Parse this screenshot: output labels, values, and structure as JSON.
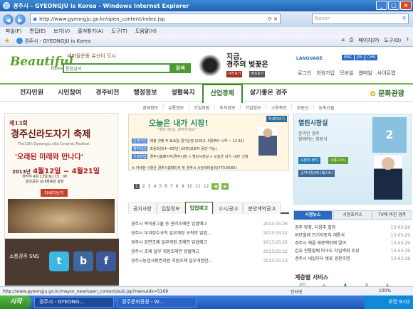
{
  "browser": {
    "title": "경주시 - GYEONGJU is Korea - Windows Internet Explorer",
    "url": "http://www.gyeongju.go.kr/open_content/index.jsp",
    "search_placeholder": "Naver",
    "menu": [
      "파일(F)",
      "편집(E)",
      "보기(V)",
      "즐겨찾기(A)",
      "도구(T)",
      "도움말(H)"
    ],
    "tab_label": "경주시 - GYEONGJU is Korea",
    "tools": [
      "페이지(P)",
      "도구(O)"
    ],
    "status_url": "http://www.gyeongju.go.kr/mayor_new/open_content/sub.jsp?menuIdx=5169",
    "status_zone": "인터넷",
    "zoom": "100%"
  },
  "taskbar": {
    "start": "시작",
    "tasks": [
      "경주시 - GYEONG...",
      "경주문화관광 - W..."
    ],
    "clock": "오전 9:02"
  },
  "site": {
    "logo": "Beautiful",
    "logo_sub": "Gyeongju",
    "slogan": "새마을운동 유산이 도시",
    "search_select": "통합검색",
    "search_btn": "검색",
    "promo_line1": "지금,",
    "promo_line2": "경주의 벚꽃은",
    "promo_btn1": "사진보기",
    "promo_btn2": "영상보기",
    "language": "LANGUAGE",
    "langs": [
      "ENG",
      "JPN",
      "CHN"
    ],
    "toplinks": [
      "로그인",
      "회원가입",
      "모바일",
      "웹메일",
      "사이트맵"
    ],
    "gnb": [
      "전자민원",
      "시민참여",
      "경주비전",
      "행정정보",
      "생활복지",
      "산업경제",
      "살기좋은 경주"
    ],
    "culture": "문화관광",
    "subnav": [
      "경제정보",
      "유통정보",
      "기업지원",
      "투자정보",
      "기업정보",
      "고용촉진",
      "부동산",
      "농축산물"
    ]
  },
  "festival": {
    "head": "제13회",
    "title": "경주신라도자기 축제",
    "en": "The13th Gyeongju silla Ceramic Festival",
    "slogan": "'오래된 미래와 만나다'",
    "date_prefix": "2013년",
    "date1": "4월12일",
    "date_sep": " ~ ",
    "date2": "4월21일",
    "info1": "개막식 4월 13일(토) 15 : 00",
    "info2": "황성공원 실내체육관 광장",
    "btn": "자세히보기",
    "sns_label": "소통경주 SNS"
  },
  "center_banner": {
    "title": "오늘은 내가 시장!",
    "sub": "\"열린시장실, 참여하세요!\"",
    "more": "자세히보기",
    "rows": [
      {
        "tag": "운영기간",
        "text": "매월 넷째 주 토요일 경기운영 (2013. 3월부터 시작 ~ 12.31)"
      },
      {
        "tag": "참여대상",
        "text": "초등학생(4~6학년) 20명(보호자 동반 가능)"
      },
      {
        "tag": "신청방법",
        "text": "경주시홈페이지/경주시청 > 열린시장실 > 오늘은 내가 시장! 신청"
      }
    ],
    "note": "※ 자세한 사항은 경주시홈페이지 및 경주시 시정새마을과(779.6583)"
  },
  "pager": [
    "1",
    "2",
    "3",
    "4",
    "5",
    "6",
    "7",
    "8",
    "9",
    "10",
    "11",
    "12"
  ],
  "news": {
    "tabs": [
      "공지사항",
      "입찰정보",
      "입법예고",
      "고시/공고",
      "분양계약공고"
    ],
    "active": 2,
    "items": [
      {
        "title": "경주시 옥외광고물 등 관리조례안 입법예고",
        "date": "2013.03.26"
      },
      {
        "title": "경주시 부과징수규칙 일부개정 규칙안 입법...",
        "date": "2013.03.22"
      },
      {
        "title": "경주시 감면조례 일부개정 조례안 입법예고",
        "date": "2013.03.22"
      },
      {
        "title": "경주시 조례 일부 개정조례안 입법예고",
        "date": "2013.03.22"
      },
      {
        "title": "경주시농업사용권지원 지원조례 일부개정안...",
        "date": "2013.03.13"
      }
    ]
  },
  "right": {
    "title": "열린시장실",
    "p1": "온라인 경주",
    "p2": "함께하는 희망식",
    "btn1": "시장의 생각",
    "btn2": "소통 24시",
    "btn3": "공약사항(매니페스토)",
    "calendar": "2",
    "tabs": [
      "시정뉴스",
      "시정포커스",
      "TV에 비친 경주"
    ],
    "items": [
      {
        "title": "경주 벚꽃, 다음주 절정",
        "date": "13-03-29"
      },
      {
        "title": "비단벌레 전기자동차 개통식",
        "date": "13-03-29"
      },
      {
        "title": "경주시 해을 재봉헥밖에 열어",
        "date": "13-03-29"
      },
      {
        "title": "갑호 전통할배 마구도 타일벽화 조성",
        "date": "13-03-29"
      },
      {
        "title": "경주시 내일부터 벚꽃 경판조명",
        "date": "13-03-28"
      }
    ],
    "service": "계층별 서비스"
  }
}
